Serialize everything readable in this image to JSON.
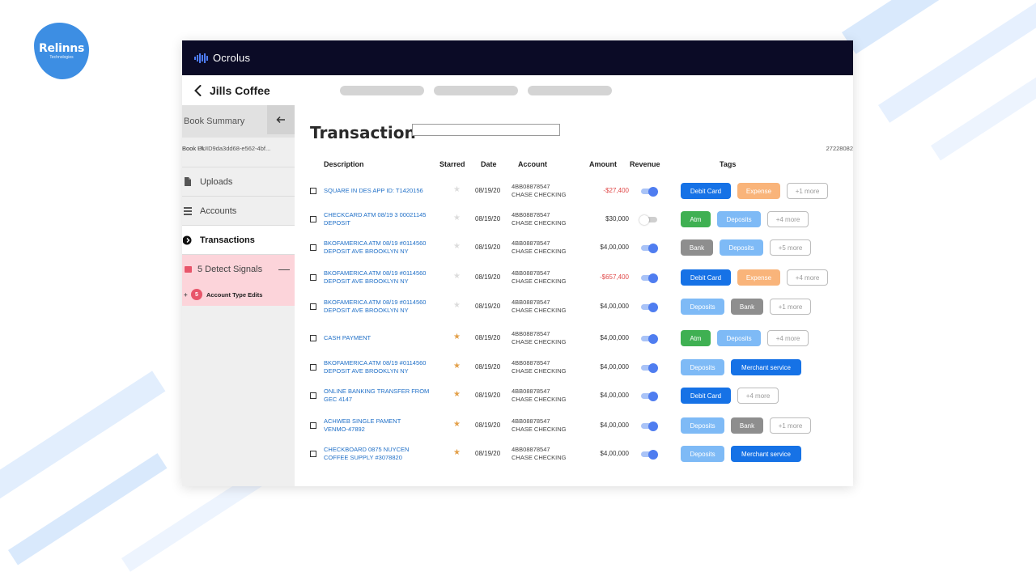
{
  "brand": {
    "logo_text": "Relinns",
    "logo_subtext": "Technologies",
    "app_name": "Ocrolus"
  },
  "header": {
    "client_name": "Jills Coffee"
  },
  "sidebar": {
    "summary_label": "Book Summary",
    "book_uuid": "Book UUID9da3dd68-e562-4bf...",
    "book_pk_label": "Book Pk",
    "book_pk_value": "27228082",
    "items": [
      {
        "label": "Uploads",
        "icon": "upload-icon"
      },
      {
        "label": "Accounts",
        "icon": "list-icon"
      },
      {
        "label": "Transactions",
        "icon": "transactions-icon",
        "active": true
      }
    ],
    "signals": {
      "label": "5 Detect Signals",
      "sub_badge": "5",
      "sub_label": "Account Type Edits"
    }
  },
  "main": {
    "title": "Transaction",
    "search_value": "",
    "columns": [
      "Description",
      "Starred",
      "Date",
      "Account",
      "Amount",
      "Revenue",
      "Tags"
    ]
  },
  "colors": {
    "topbar": "#0b0b26",
    "link": "#1f6fc7",
    "negative": "#e04848",
    "toggle_on": "#4f7df0",
    "star_on": "#e3a04a",
    "star_off": "#dcdcdc"
  },
  "rows": [
    {
      "desc": [
        "SQUARE IN DES APP ID: T1420156"
      ],
      "starred": false,
      "date": "08/19/20",
      "acct": [
        "4BB08878547",
        "CHASE CHECKING"
      ],
      "amount": "-$27,400",
      "negative": true,
      "revenue": true,
      "tags": [
        {
          "label": "Debit Card",
          "type": "debit"
        },
        {
          "label": "Expense",
          "type": "expense"
        },
        {
          "label": "+1 more",
          "type": "more"
        }
      ]
    },
    {
      "desc": [
        "CHECKCARD ATM 08/19 3 00021145",
        "DEPOSIT"
      ],
      "starred": false,
      "date": "08/19/20",
      "acct": [
        "4BB08878547",
        "CHASE CHECKING"
      ],
      "amount": "$30,000",
      "negative": false,
      "revenue": false,
      "tags": [
        {
          "label": "Atm",
          "type": "atm"
        },
        {
          "label": "Deposits",
          "type": "deposits"
        },
        {
          "label": "+4 more",
          "type": "more"
        }
      ]
    },
    {
      "desc": [
        "BKOFAMERICA ATM 08/19 #0114560",
        "DEPOSIT AVE BROOKLYN NY"
      ],
      "starred": false,
      "date": "08/19/20",
      "acct": [
        "4BB08878547",
        "CHASE CHECKING"
      ],
      "amount": "$4,00,000",
      "negative": false,
      "revenue": true,
      "tags": [
        {
          "label": "Bank",
          "type": "bank"
        },
        {
          "label": "Deposits",
          "type": "deposits"
        },
        {
          "label": "+5 more",
          "type": "more"
        }
      ]
    },
    {
      "desc": [
        "BKOFAMERICA ATM 08/19 #0114560",
        "DEPOSIT AVE BROOKLYN NY"
      ],
      "starred": false,
      "date": "08/19/20",
      "acct": [
        "4BB08878547",
        "CHASE CHECKING"
      ],
      "amount": "-$657,400",
      "negative": true,
      "revenue": true,
      "tags": [
        {
          "label": "Debit Card",
          "type": "debit"
        },
        {
          "label": "Expense",
          "type": "expense"
        },
        {
          "label": "+4 more",
          "type": "more"
        }
      ]
    },
    {
      "desc": [
        "BKOFAMERICA ATM 08/19 #0114560",
        "DEPOSIT AVE BROOKLYN NY"
      ],
      "starred": false,
      "date": "08/19/20",
      "acct": [
        "4BB08878547",
        "CHASE CHECKING"
      ],
      "amount": "$4,00,000",
      "negative": false,
      "revenue": true,
      "tags": [
        {
          "label": "Deposits",
          "type": "deposits"
        },
        {
          "label": "Bank",
          "type": "bank"
        },
        {
          "label": "+1 more",
          "type": "more"
        }
      ]
    },
    {
      "desc": [
        "CASH PAYMENT"
      ],
      "starred": true,
      "date": "08/19/20",
      "acct": [
        "4BB08878547",
        "CHASE CHECKING"
      ],
      "amount": "$4,00,000",
      "negative": false,
      "revenue": true,
      "tags": [
        {
          "label": "Atm",
          "type": "atm"
        },
        {
          "label": "Deposits",
          "type": "deposits"
        },
        {
          "label": "+4 more",
          "type": "more"
        }
      ]
    },
    {
      "desc": [
        "BKOFAMERICA ATM 08/19 #0114560",
        "DEPOSIT AVE BROOKLYN NY"
      ],
      "starred": true,
      "date": "08/19/20",
      "acct": [
        "4BB08878547",
        "CHASE CHECKING"
      ],
      "amount": "$4,00,000",
      "negative": false,
      "revenue": true,
      "tags": [
        {
          "label": "Deposits",
          "type": "deposits"
        },
        {
          "label": "Merchant service",
          "type": "merchant"
        }
      ]
    },
    {
      "desc": [
        "ONLINE BANKING TRANSFER FROM",
        "GEC 4147"
      ],
      "starred": true,
      "date": "08/19/20",
      "acct": [
        "4BB08878547",
        "CHASE CHECKING"
      ],
      "amount": "$4,00,000",
      "negative": false,
      "revenue": true,
      "tags": [
        {
          "label": "Debit Card",
          "type": "debit"
        },
        {
          "label": "+4 more",
          "type": "more"
        }
      ]
    },
    {
      "desc": [
        "ACHWEB SINGLE PAMENT",
        "VENMO-47892"
      ],
      "starred": true,
      "date": "08/19/20",
      "acct": [
        "4BB08878547",
        "CHASE CHECKING"
      ],
      "amount": "$4,00,000",
      "negative": false,
      "revenue": true,
      "tags": [
        {
          "label": "Deposits",
          "type": "deposits"
        },
        {
          "label": "Bank",
          "type": "bank"
        },
        {
          "label": "+1 more",
          "type": "more"
        }
      ]
    },
    {
      "desc": [
        "CHECKBOARD 0875 NUYCEN",
        "COFFEE SUPPLY #3078820"
      ],
      "starred": true,
      "date": "08/19/20",
      "acct": [
        "4BB08878547",
        "CHASE CHECKING"
      ],
      "amount": "$4,00,000",
      "negative": false,
      "revenue": true,
      "tags": [
        {
          "label": "Deposits",
          "type": "deposits"
        },
        {
          "label": "Merchant service",
          "type": "merchant"
        }
      ]
    }
  ]
}
